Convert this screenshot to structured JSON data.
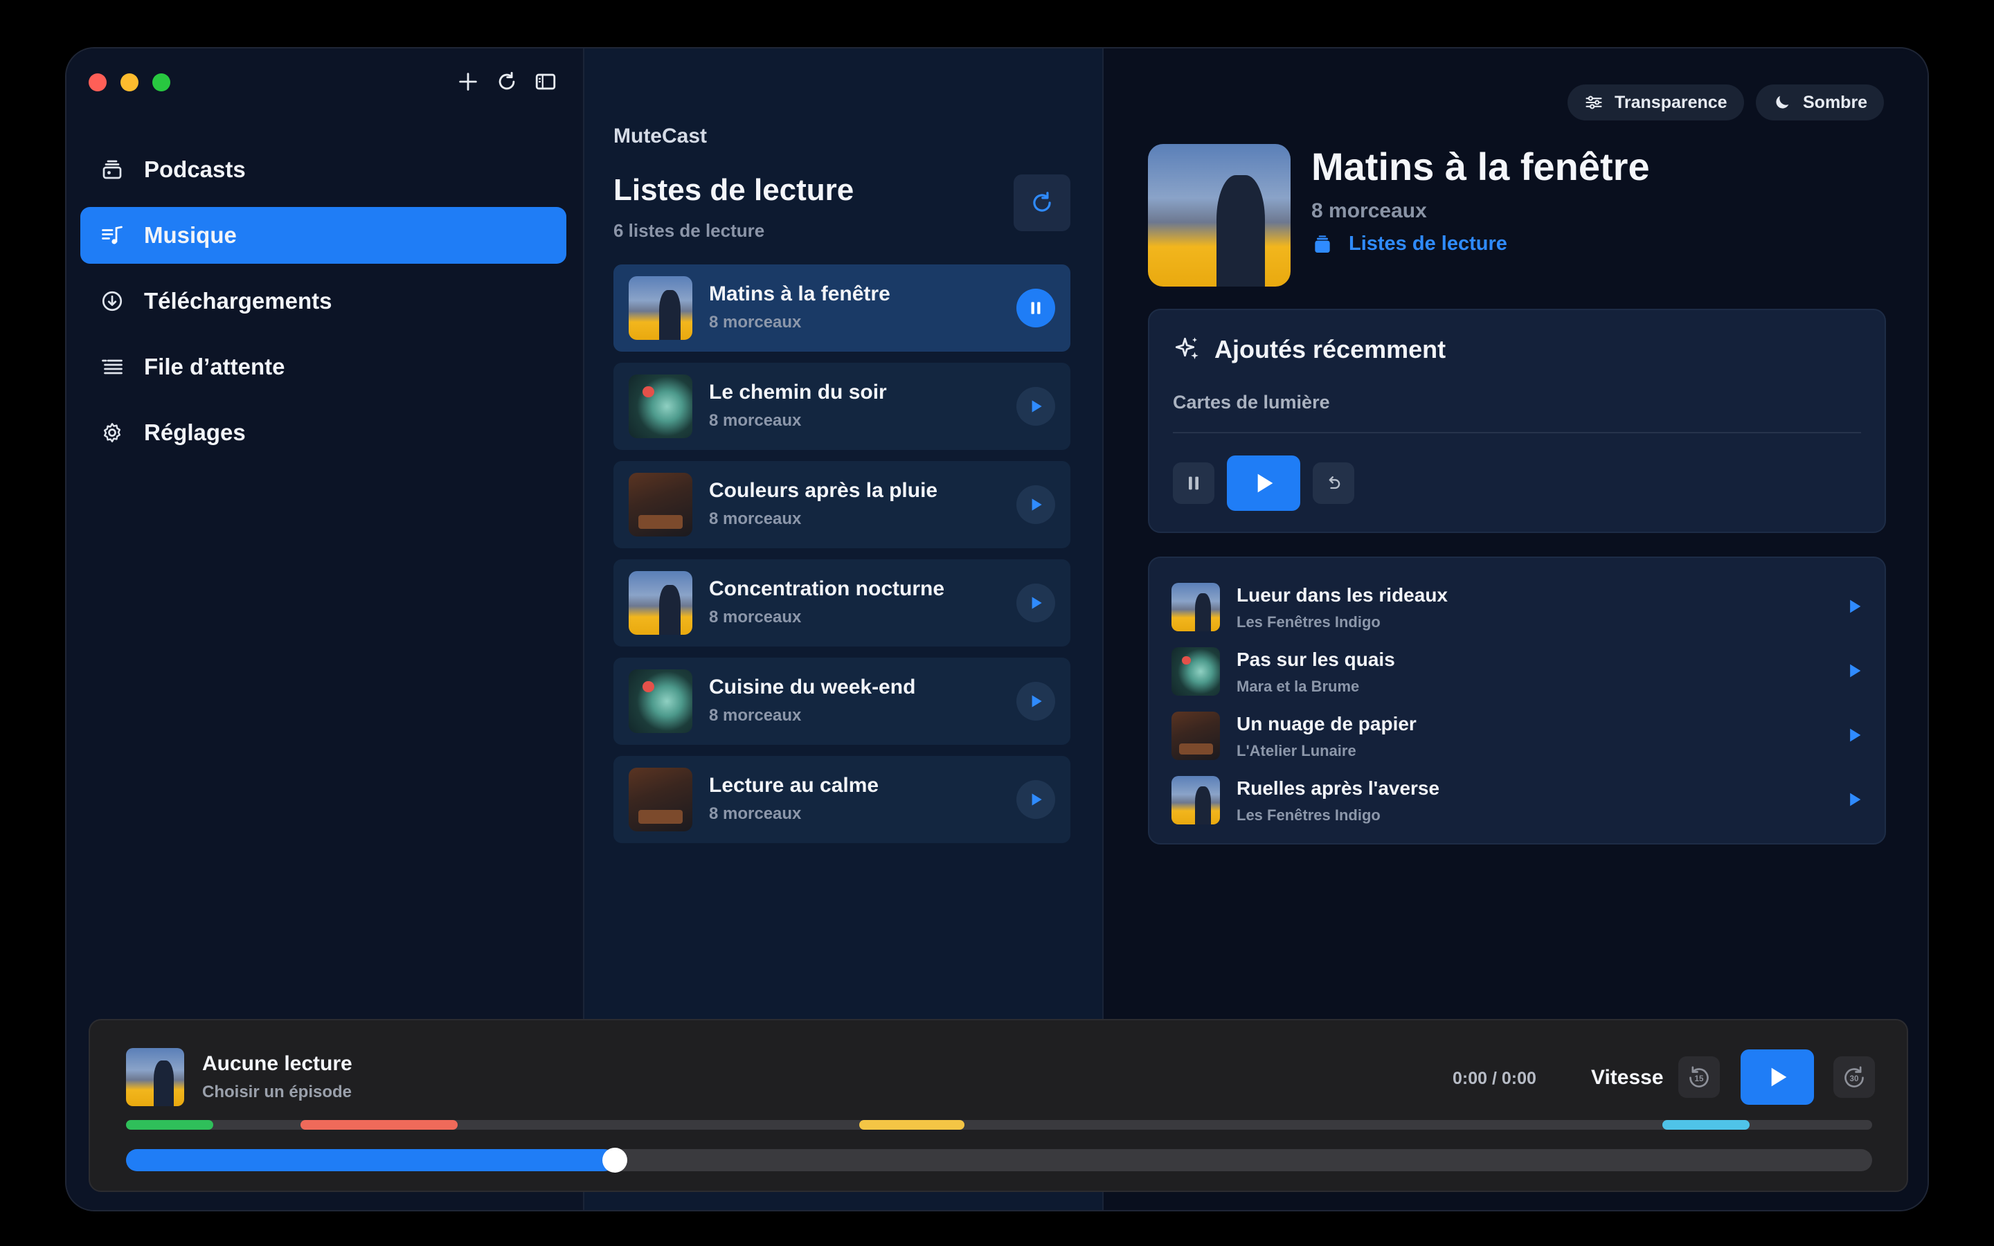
{
  "sidebar": {
    "items": [
      {
        "id": "podcasts",
        "label": "Podcasts",
        "icon": "podcasts-icon",
        "active": false
      },
      {
        "id": "musique",
        "label": "Musique",
        "icon": "music-icon",
        "active": true
      },
      {
        "id": "telechargements",
        "label": "Téléchargements",
        "icon": "download-icon",
        "active": false
      },
      {
        "id": "file",
        "label": "File d’attente",
        "icon": "queue-icon",
        "active": false
      },
      {
        "id": "reglages",
        "label": "Réglages",
        "icon": "gear-icon",
        "active": false
      }
    ]
  },
  "toolbar": {
    "icons": [
      "plus-icon",
      "refresh-icon",
      "sidebar-toggle-icon"
    ]
  },
  "middle": {
    "app_name": "MuteCast",
    "title": "Listes de lecture",
    "subtitle": "6 listes de lecture",
    "playlists": [
      {
        "name": "Matins à la fenêtre",
        "count": "8 morceaux",
        "art": "a",
        "active": true
      },
      {
        "name": "Le chemin du soir",
        "count": "8 morceaux",
        "art": "b",
        "active": false
      },
      {
        "name": "Couleurs après la pluie",
        "count": "8 morceaux",
        "art": "c",
        "active": false
      },
      {
        "name": "Concentration nocturne",
        "count": "8 morceaux",
        "art": "a",
        "active": false
      },
      {
        "name": "Cuisine du week-end",
        "count": "8 morceaux",
        "art": "b",
        "active": false
      },
      {
        "name": "Lecture au calme",
        "count": "8 morceaux",
        "art": "c",
        "active": false
      }
    ]
  },
  "right": {
    "transparence_label": "Transparence",
    "sombre_label": "Sombre",
    "hero": {
      "title": "Matins à la fenêtre",
      "subtitle": "8 morceaux",
      "link": "Listes de lecture"
    },
    "recent": {
      "title": "Ajoutés récemment",
      "track": "Cartes de lumière"
    },
    "tracks": [
      {
        "title": "Lueur dans les rideaux",
        "artist": "Les Fenêtres Indigo",
        "art": "a"
      },
      {
        "title": "Pas sur les quais",
        "artist": "Mara et la Brume",
        "art": "b"
      },
      {
        "title": "Un nuage de papier",
        "artist": "L'Atelier Lunaire",
        "art": "c"
      },
      {
        "title": "Ruelles après l'averse",
        "artist": "Les Fenêtres Indigo",
        "art": "a"
      }
    ]
  },
  "player": {
    "title": "Aucune lecture",
    "subtitle": "Choisir un épisode",
    "time": "0:00 / 0:00",
    "speed_label": "Vitesse",
    "progress_fraction": 0.28,
    "chapters": [
      {
        "start": 0.0,
        "end": 0.05,
        "color": "#2fbf5a"
      },
      {
        "start": 0.1,
        "end": 0.19,
        "color": "#ef6a5a"
      },
      {
        "start": 0.42,
        "end": 0.48,
        "color": "#f4c545"
      },
      {
        "start": 0.88,
        "end": 0.93,
        "color": "#4fc3e8"
      }
    ]
  },
  "colors": {
    "accent": "#1f7df6",
    "link": "#2f8bff"
  }
}
